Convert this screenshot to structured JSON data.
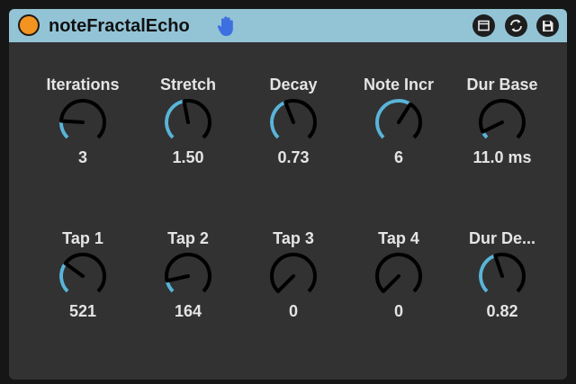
{
  "device": {
    "title": "noteFractalEcho",
    "colors": {
      "titlebar": "#92c4d6",
      "power": "#f39420",
      "hand_icon": "#3e6fe0",
      "panel": "#323232",
      "knob_arc": "#5ab4d8",
      "knob_ring": "#000000",
      "text": "#e4e4e4"
    },
    "icons": {
      "power": "power-button-icon",
      "hand": "hand-icon",
      "buttons": [
        "window-icon",
        "refresh-icon",
        "save-icon"
      ]
    }
  },
  "knobs": [
    {
      "label": "Iterations",
      "value": "3",
      "level": 0.18
    },
    {
      "label": "Stretch",
      "value": "1.50",
      "level": 0.46
    },
    {
      "label": "Decay",
      "value": "0.73",
      "level": 0.42
    },
    {
      "label": "Note Incr",
      "value": "6",
      "level": 0.62
    },
    {
      "label": "Dur Base",
      "value": "11.0 ms",
      "level": 0.07
    },
    {
      "label": "Tap 1",
      "value": "521",
      "level": 0.3
    },
    {
      "label": "Tap 2",
      "value": "164",
      "level": 0.12
    },
    {
      "label": "Tap 3",
      "value": "0",
      "level": 0.0
    },
    {
      "label": "Tap 4",
      "value": "0",
      "level": 0.0
    },
    {
      "label": "Dur De...",
      "value": "0.82",
      "level": 0.43
    }
  ]
}
